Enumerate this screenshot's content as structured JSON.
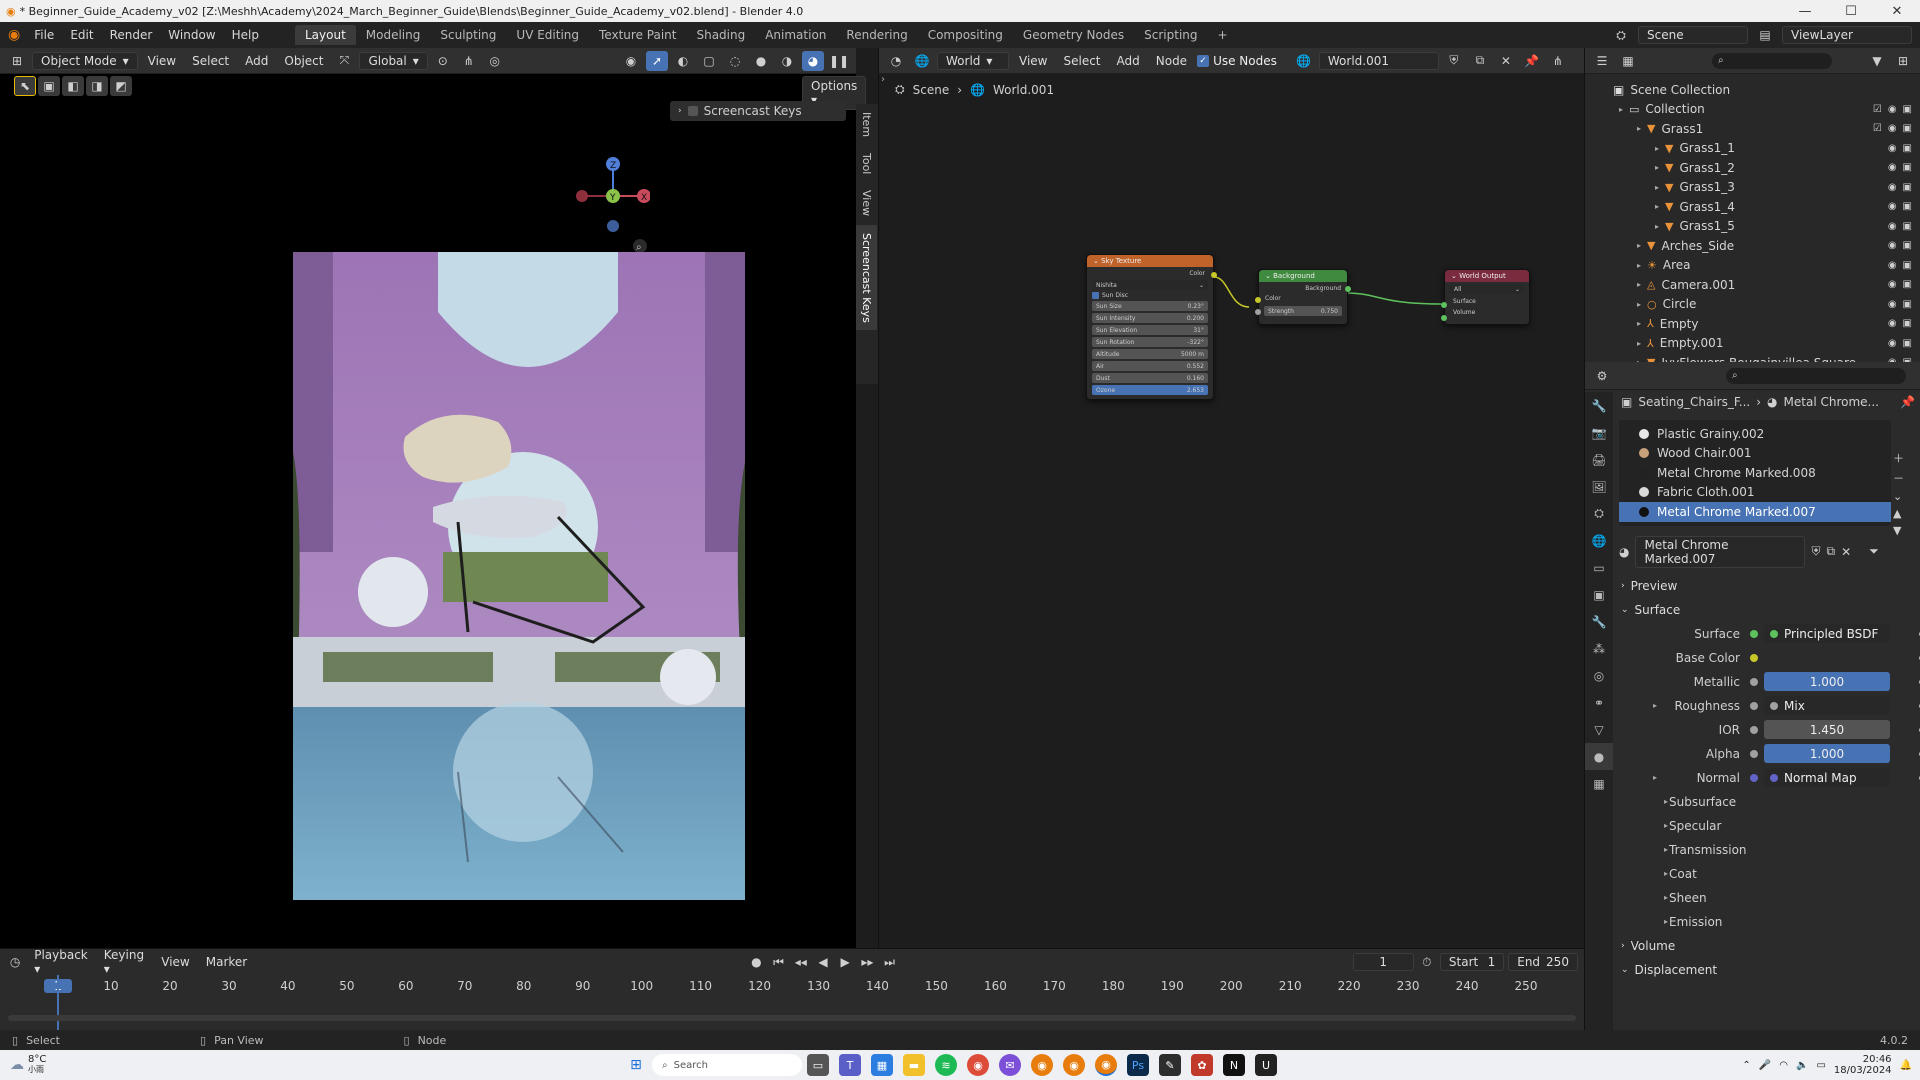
{
  "window": {
    "title": "* Beginner_Guide_Academy_v02 [Z:\\Meshh\\Academy\\2024_March_Beginner_Guide\\Blends\\Beginner_Guide_Academy_v02.blend] - Blender 4.0",
    "min": "—",
    "max": "☐",
    "close": "✕"
  },
  "menu": [
    "File",
    "Edit",
    "Render",
    "Window",
    "Help"
  ],
  "workspaces": [
    "Layout",
    "Modeling",
    "Sculpting",
    "UV Editing",
    "Texture Paint",
    "Shading",
    "Animation",
    "Rendering",
    "Compositing",
    "Geometry Nodes",
    "Scripting"
  ],
  "add_workspace": "+",
  "scene": {
    "label": "Scene",
    "viewlayer": "ViewLayer"
  },
  "viewport": {
    "mode": "Object Mode",
    "menus": [
      "View",
      "Select",
      "Add",
      "Object"
    ],
    "transform": "Global",
    "options": "Options",
    "screencast_panel": "Screencast Keys",
    "side_tabs": [
      "Item",
      "Tool",
      "View",
      "Screencast Keys"
    ],
    "gizmo": {
      "z": "Z",
      "y": "Y",
      "x": "X"
    }
  },
  "node_editor": {
    "type": "World",
    "menus": [
      "View",
      "Select",
      "Add",
      "Node"
    ],
    "use_nodes": "Use Nodes",
    "world_name": "World.001",
    "breadcrumb": [
      "Scene",
      "World.001"
    ],
    "sky": {
      "title": "Sky Texture",
      "out": "Color",
      "type": "Nishita",
      "sun_disc": "Sun Disc",
      "fields": [
        {
          "label": "Sun Size",
          "value": "0.23°"
        },
        {
          "label": "Sun Intensity",
          "value": "0.200"
        },
        {
          "label": "Sun Elevation",
          "value": "31°"
        },
        {
          "label": "Sun Rotation",
          "value": "-322°"
        },
        {
          "label": "Altitude",
          "value": "5000 m"
        },
        {
          "label": "Air",
          "value": "0.552"
        },
        {
          "label": "Dust",
          "value": "0.160"
        },
        {
          "label": "Ozone",
          "value": "2.653"
        }
      ]
    },
    "background": {
      "title": "Background",
      "out": "Background",
      "color": "Color",
      "strength_label": "Strength",
      "strength": "0.750"
    },
    "world_output": {
      "title": "World Output",
      "target": "All",
      "surface": "Surface",
      "volume": "Volume"
    }
  },
  "outliner": {
    "root": "Scene Collection",
    "items": [
      {
        "label": "Collection",
        "indent": 1
      },
      {
        "label": "Grass1",
        "indent": 2
      },
      {
        "label": "Grass1_1",
        "indent": 3
      },
      {
        "label": "Grass1_2",
        "indent": 3
      },
      {
        "label": "Grass1_3",
        "indent": 3
      },
      {
        "label": "Grass1_4",
        "indent": 3
      },
      {
        "label": "Grass1_5",
        "indent": 3
      },
      {
        "label": "Arches_Side",
        "indent": 2
      },
      {
        "label": "Area",
        "indent": 2
      },
      {
        "label": "Camera.001",
        "indent": 2
      },
      {
        "label": "Circle",
        "indent": 2
      },
      {
        "label": "Empty",
        "indent": 2
      },
      {
        "label": "Empty.001",
        "indent": 2
      },
      {
        "label": "IvyFlowers Bougainvillea Square",
        "indent": 2
      }
    ]
  },
  "properties": {
    "breadcrumb": [
      "Seating_Chairs_F...",
      "Metal Chrome..."
    ],
    "materials": [
      {
        "label": "Plastic Grainy.002",
        "color": "#e8e8e8"
      },
      {
        "label": "Wood Chair.001",
        "color": "#c8a27a"
      },
      {
        "label": "Metal Chrome Marked.008",
        "color": "#222222"
      },
      {
        "label": "Fabric Cloth.001",
        "color": "#d9d9d9"
      },
      {
        "label": "Metal Chrome Marked.007",
        "color": "#111111"
      }
    ],
    "material_name": "Metal Chrome Marked.007",
    "preview": "Preview",
    "surface_panel": "Surface",
    "rows": [
      {
        "label": "Surface",
        "value": "Principled BSDF",
        "style": "dark",
        "dot": "#5ec25e"
      },
      {
        "label": "Base Color",
        "value": "",
        "style": "none",
        "dot": "#c7c729"
      },
      {
        "label": "Metallic",
        "value": "1.000",
        "style": "blue",
        "dot": "#a1a1a1"
      },
      {
        "label": "Roughness",
        "value": "Mix",
        "style": "dark",
        "dot": "#a1a1a1"
      },
      {
        "label": "IOR",
        "value": "1.450",
        "style": "grey",
        "dot": "#a1a1a1"
      },
      {
        "label": "Alpha",
        "value": "1.000",
        "style": "blue",
        "dot": "#a1a1a1"
      },
      {
        "label": "Normal",
        "value": "Normal Map",
        "style": "dark",
        "dot": "#6363c7"
      }
    ],
    "subpanels": [
      "Subsurface",
      "Specular",
      "Transmission",
      "Coat",
      "Sheen",
      "Emission"
    ],
    "volume": "Volume",
    "displacement": "Displacement"
  },
  "timeline": {
    "menus": [
      "Playback",
      "Keying",
      "View",
      "Marker"
    ],
    "current": "1",
    "start_label": "Start",
    "start": "1",
    "end_label": "End",
    "end": "250",
    "ticks": [
      "1",
      "10",
      "20",
      "30",
      "40",
      "50",
      "60",
      "70",
      "80",
      "90",
      "100",
      "110",
      "120",
      "130",
      "140",
      "150",
      "160",
      "170",
      "180",
      "190",
      "200",
      "210",
      "220",
      "230",
      "240",
      "250"
    ]
  },
  "status": {
    "left": "Select",
    "mid": "Pan View",
    "right": "Node",
    "version": "4.0.2"
  },
  "taskbar": {
    "weather": "8°C",
    "weather_sub": "小雨",
    "search": "Search",
    "time": "20:46",
    "date": "18/03/2024"
  },
  "colors": {
    "accent": "#4772b3",
    "sky_header": "#c0632a",
    "bg_header": "#3f8a3f",
    "out_header": "#7a2c3e"
  }
}
